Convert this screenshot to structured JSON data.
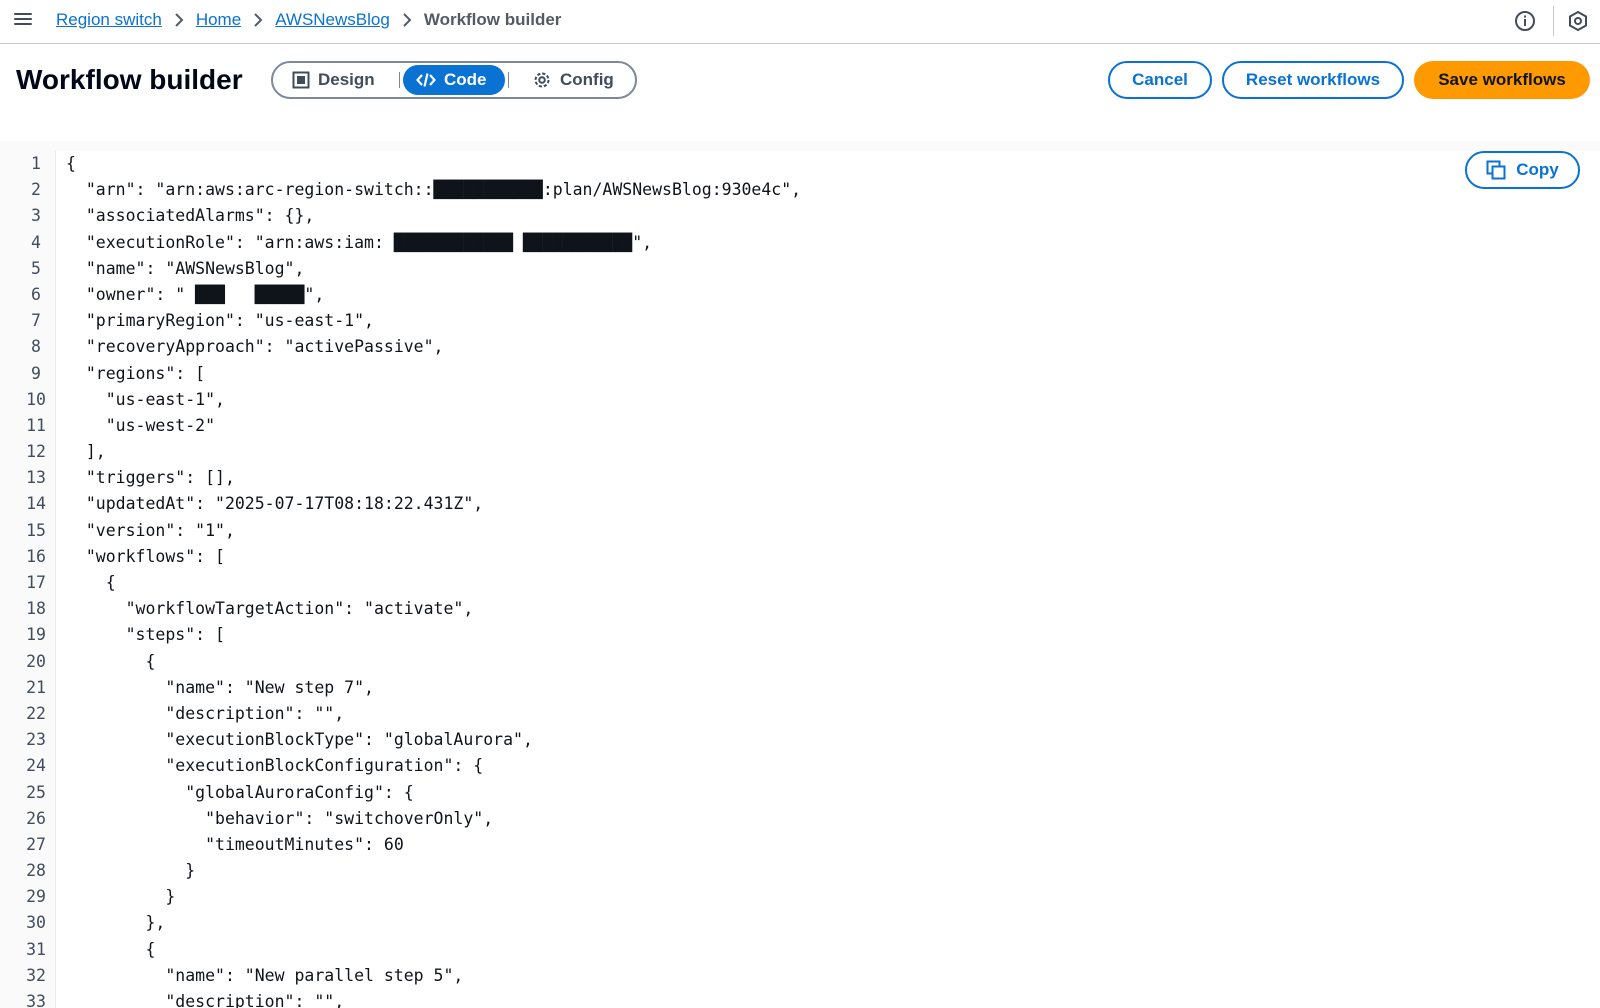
{
  "breadcrumb": {
    "items": [
      {
        "label": "Region switch"
      },
      {
        "label": "Home"
      },
      {
        "label": "AWSNewsBlog"
      },
      {
        "label": "Workflow builder"
      }
    ]
  },
  "header": {
    "title": "Workflow builder",
    "view_modes": [
      {
        "label": "Design",
        "icon": "layout-icon"
      },
      {
        "label": "Code",
        "icon": "code-icon",
        "selected": true
      },
      {
        "label": "Config",
        "icon": "gear-icon"
      }
    ],
    "cancel_label": "Cancel",
    "reset_label": "Reset workflows",
    "save_label": "Save workflows"
  },
  "editor": {
    "copy_label": "Copy",
    "lines": [
      {
        "n": "1",
        "text": "{"
      },
      {
        "n": "2",
        "text": "  \"arn\": \"arn:aws:arc-region-switch::███████████:plan/AWSNewsBlog:930e4c\","
      },
      {
        "n": "3",
        "text": "  \"associatedAlarms\": {},"
      },
      {
        "n": "4",
        "text": "  \"executionRole\": \"arn:aws:iam: ████████████ ███████████\","
      },
      {
        "n": "5",
        "text": "  \"name\": \"AWSNewsBlog\","
      },
      {
        "n": "6",
        "text": "  \"owner\": \" ███   █████\","
      },
      {
        "n": "7",
        "text": "  \"primaryRegion\": \"us-east-1\","
      },
      {
        "n": "8",
        "text": "  \"recoveryApproach\": \"activePassive\","
      },
      {
        "n": "9",
        "text": "  \"regions\": ["
      },
      {
        "n": "10",
        "text": "    \"us-east-1\","
      },
      {
        "n": "11",
        "text": "    \"us-west-2\""
      },
      {
        "n": "12",
        "text": "  ],"
      },
      {
        "n": "13",
        "text": "  \"triggers\": [],"
      },
      {
        "n": "14",
        "text": "  \"updatedAt\": \"2025-07-17T08:18:22.431Z\","
      },
      {
        "n": "15",
        "text": "  \"version\": \"1\","
      },
      {
        "n": "16",
        "text": "  \"workflows\": ["
      },
      {
        "n": "17",
        "text": "    {"
      },
      {
        "n": "18",
        "text": "      \"workflowTargetAction\": \"activate\","
      },
      {
        "n": "19",
        "text": "      \"steps\": ["
      },
      {
        "n": "20",
        "text": "        {"
      },
      {
        "n": "21",
        "text": "          \"name\": \"New step 7\","
      },
      {
        "n": "22",
        "text": "          \"description\": \"\","
      },
      {
        "n": "23",
        "text": "          \"executionBlockType\": \"globalAurora\","
      },
      {
        "n": "24",
        "text": "          \"executionBlockConfiguration\": {"
      },
      {
        "n": "25",
        "text": "            \"globalAuroraConfig\": {"
      },
      {
        "n": "26",
        "text": "              \"behavior\": \"switchoverOnly\","
      },
      {
        "n": "27",
        "text": "              \"timeoutMinutes\": 60"
      },
      {
        "n": "28",
        "text": "            }"
      },
      {
        "n": "29",
        "text": "          }"
      },
      {
        "n": "30",
        "text": "        },"
      },
      {
        "n": "31",
        "text": "        {"
      },
      {
        "n": "32",
        "text": "          \"name\": \"New parallel step 5\","
      },
      {
        "n": "33",
        "text": "          \"description\": \"\","
      }
    ]
  },
  "colors": {
    "link": "#0972d3",
    "primary_button": "#ff9900",
    "selected_segment": "#0972d3"
  }
}
